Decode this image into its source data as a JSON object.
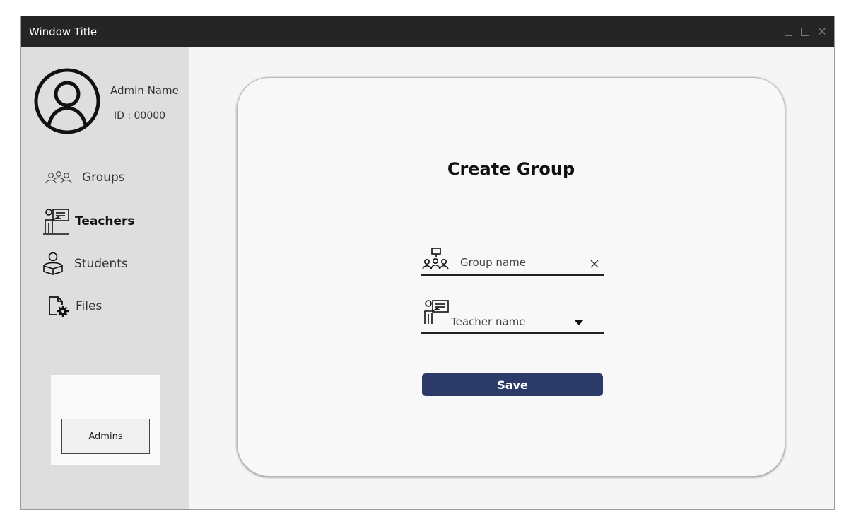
{
  "window": {
    "title": "Window Title",
    "controls": [
      "minimize-icon",
      "maximize-icon",
      "close-icon"
    ]
  },
  "sidebar": {
    "admin_name": "Admin Name",
    "admin_id": "ID : 00000",
    "items": [
      {
        "label": "Groups",
        "icon": "groups-icon",
        "active": false
      },
      {
        "label": "Teachers",
        "icon": "teacher-icon",
        "active": true
      },
      {
        "label": "Students",
        "icon": "student-icon",
        "active": false
      },
      {
        "label": "Files",
        "icon": "file-settings-icon",
        "active": false
      }
    ],
    "admins_button": "Admins"
  },
  "form": {
    "title": "Create Group",
    "group_name_placeholder": "Group name",
    "teacher_name_placeholder": "Teacher name",
    "save_label": "Save"
  },
  "colors": {
    "titlebar": "#252525",
    "sidebar": "#dedede",
    "primary_button": "#2b3a67"
  }
}
